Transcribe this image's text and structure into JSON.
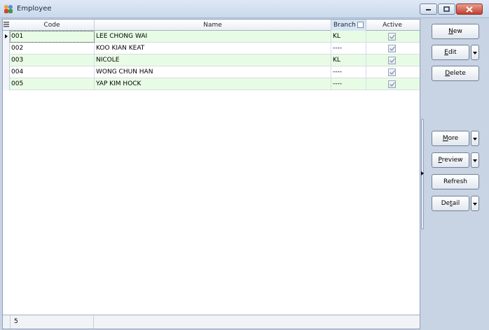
{
  "window": {
    "title": "Employee",
    "icon": "employee-group-icon"
  },
  "grid": {
    "columns": [
      "Code",
      "Name",
      "Branch",
      "Active"
    ],
    "rows": [
      {
        "code": "001",
        "name": "LEE CHONG WAI",
        "branch": "KL",
        "active": true
      },
      {
        "code": "002",
        "name": "KOO KIAN KEAT",
        "branch": "----",
        "active": true
      },
      {
        "code": "003",
        "name": "NICOLE",
        "branch": "KL",
        "active": true
      },
      {
        "code": "004",
        "name": "WONG CHUN HAN",
        "branch": "----",
        "active": true
      },
      {
        "code": "005",
        "name": "YAP KIM HOCK",
        "branch": "----",
        "active": true
      }
    ],
    "record_count": "5"
  },
  "buttons": {
    "new": {
      "prefix": "",
      "mnemonic": "N",
      "suffix": "ew"
    },
    "edit": {
      "prefix": "",
      "mnemonic": "E",
      "suffix": "dit"
    },
    "delete": {
      "prefix": "",
      "mnemonic": "D",
      "suffix": "elete"
    },
    "more": {
      "prefix": "",
      "mnemonic": "M",
      "suffix": "ore"
    },
    "preview": {
      "prefix": "",
      "mnemonic": "P",
      "suffix": "review"
    },
    "refresh": {
      "label": "Refresh"
    },
    "detail": {
      "prefix": "De",
      "mnemonic": "t",
      "suffix": "ail"
    }
  }
}
